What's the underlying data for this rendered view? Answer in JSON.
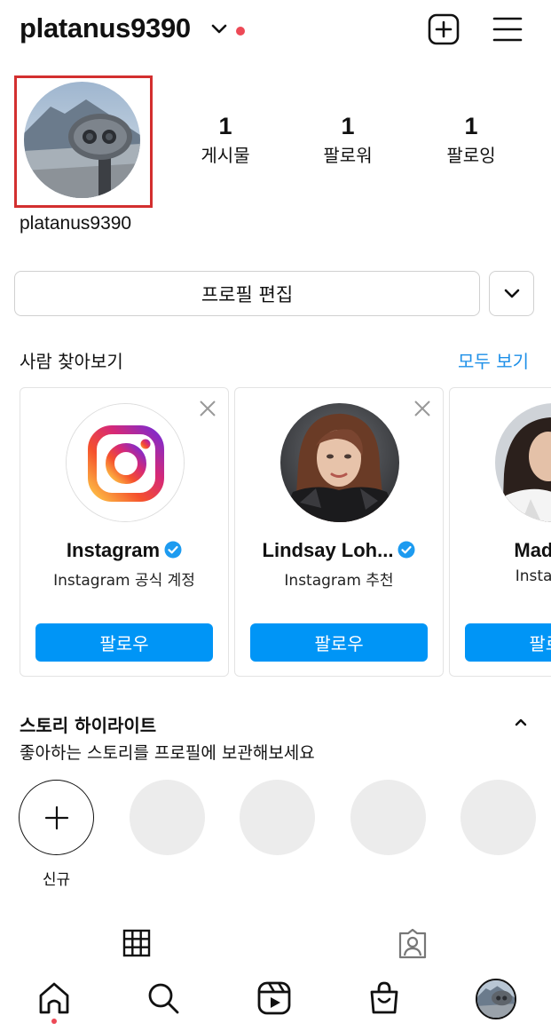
{
  "header": {
    "username": "platanus9390",
    "icons": {
      "account_switch": "chevron-down-icon",
      "notification": "red-dot",
      "create": "plus-square-icon",
      "menu": "hamburger-menu-icon"
    }
  },
  "profile": {
    "display_name": "platanus9390",
    "stats": [
      {
        "value": "1",
        "label": "게시물"
      },
      {
        "value": "1",
        "label": "팔로워"
      },
      {
        "value": "1",
        "label": "팔로잉"
      }
    ],
    "edit_label": "프로필 편집"
  },
  "discover": {
    "title": "사람 찾아보기",
    "see_all": "모두 보기",
    "cards": [
      {
        "name": "Instagram",
        "verified": true,
        "subtitle": "Instagram 공식 계정",
        "follow": "팔로우"
      },
      {
        "name": "Lindsay Loh...",
        "verified": true,
        "subtitle": "Instagram 추천",
        "follow": "팔로우"
      },
      {
        "name": "Madison",
        "verified": false,
        "subtitle": "Instagram",
        "follow": "팔로우"
      }
    ]
  },
  "highlights": {
    "title": "스토리 하이라이트",
    "subtitle": "좋아하는 스토리를 프로필에 보관해보세요",
    "new_label": "신규"
  },
  "colors": {
    "accent": "#0095f6",
    "link": "#1e90e8",
    "notification": "#ed4956",
    "highlight_border": "#d32f2f"
  }
}
